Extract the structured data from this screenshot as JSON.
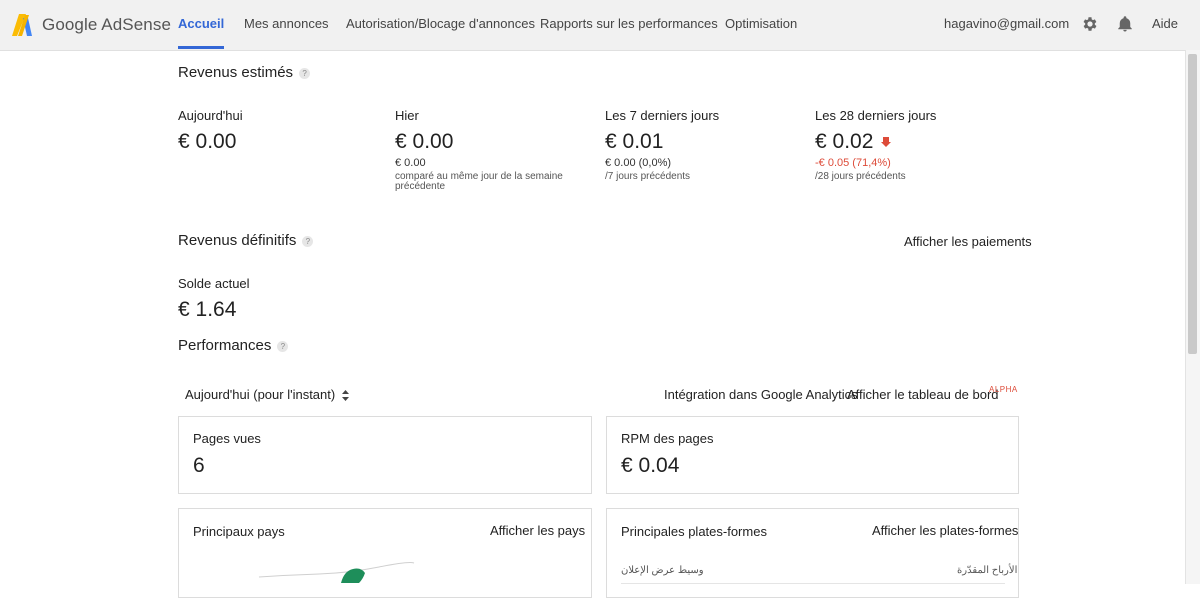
{
  "header": {
    "app_name": "Google AdSense",
    "tabs": [
      {
        "label": "Accueil"
      },
      {
        "label": "Mes annonces"
      },
      {
        "label": "Autorisation/Blocage d'annonces"
      },
      {
        "label": "Rapports sur les performances"
      },
      {
        "label": "Optimisation"
      }
    ],
    "active_tab": "Accueil",
    "user_email": "hagavino@gmail.com",
    "help_label": "Aide",
    "icons": [
      "adsense-logo-icon",
      "gear-icon",
      "bell-icon"
    ],
    "accent_color": "#3367d6"
  },
  "estimated": {
    "title": "Revenus estimés",
    "help": "?",
    "today": {
      "label": "Aujourd'hui",
      "value": "€ 0.00"
    },
    "yesterday": {
      "label": "Hier",
      "value": "€ 0.00",
      "compare": "€ 0.00",
      "note": "comparé au même jour de la semaine précédente"
    },
    "last7": {
      "label": "Les 7 derniers jours",
      "value": "€ 0.01",
      "compare": "€ 0.00 (0,0%)",
      "note": "/7 jours précédents"
    },
    "last28": {
      "label": "Les 28 derniers jours",
      "value": "€ 0.02",
      "compare": "-€ 0.05 (71,4%)",
      "note": "/28 jours précédents",
      "trend": "down",
      "trend_color": "#dd4b39"
    }
  },
  "finalized": {
    "title": "Revenus définitifs",
    "help": "?",
    "payments_link": "Afficher les paiements",
    "balance_label": "Solde actuel",
    "balance_value": "€ 1.64"
  },
  "performance": {
    "title": "Performances",
    "help": "?",
    "period_select": "Aujourd'hui (pour l'instant)",
    "analytics_link": "Intégration dans Google Analytics",
    "dashboard_link": "Afficher le tableau de bord",
    "alpha_badge": "ALPHA",
    "page_views": {
      "label": "Pages vues",
      "value": "6"
    },
    "page_rpm": {
      "label": "RPM des pages",
      "value": "€ 0.04"
    },
    "top_countries": {
      "title": "Principaux pays",
      "link": "Afficher les pays"
    },
    "top_platforms": {
      "title": "Principales plates-formes",
      "link": "Afficher les plates-formes",
      "col_left": "وسيط عرض الإعلان",
      "col_right": "الأرباح المقدّرة"
    }
  }
}
